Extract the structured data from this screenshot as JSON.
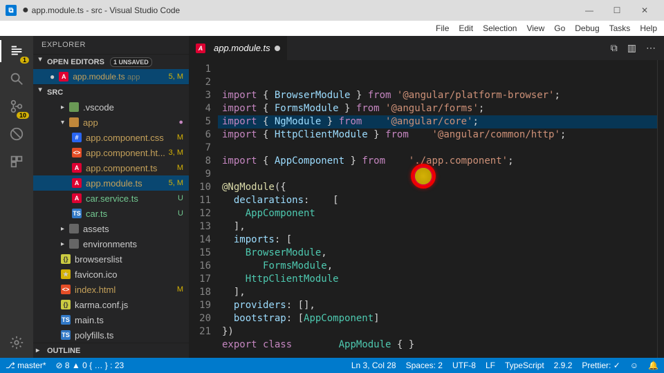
{
  "title": "app.module.ts - src - Visual Studio Code",
  "menu": [
    "Help",
    "Tasks",
    "Debug",
    "Go",
    "View",
    "Selection",
    "Edit",
    "File"
  ],
  "activity": {
    "explorer_badge": "1",
    "scm_badge": "10"
  },
  "explorer": {
    "header": "EXPLORER",
    "open_editors_label": "OPEN EDITORS",
    "unsaved_label": "1 UNSAVED",
    "open_editors": [
      {
        "name": "app.module.ts",
        "hint": "app",
        "status": "5, M",
        "mod": true
      }
    ],
    "root_label": "SRC",
    "tree": [
      {
        "depth": 2,
        "icon": "folder-green",
        "name": ".vscode",
        "chev": "▸"
      },
      {
        "depth": 2,
        "icon": "folder-orange",
        "name": "app",
        "chev": "▾",
        "status": "●",
        "statusClass": "dot",
        "mod": true
      },
      {
        "depth": 3,
        "icon": "css",
        "name": "app.component.css",
        "status": "M",
        "mod": true
      },
      {
        "depth": 3,
        "icon": "html",
        "name": "app.component.ht...",
        "status": "3, M",
        "mod": true
      },
      {
        "depth": 3,
        "icon": "ng",
        "name": "app.component.ts",
        "status": "M",
        "mod": true
      },
      {
        "depth": 3,
        "icon": "ng",
        "name": "app.module.ts",
        "status": "5, M",
        "mod": true,
        "selected": true
      },
      {
        "depth": 3,
        "icon": "ng",
        "name": "car.service.ts",
        "status": "U",
        "new": true
      },
      {
        "depth": 3,
        "icon": "ts",
        "name": "car.ts",
        "status": "U",
        "new": true
      },
      {
        "depth": 2,
        "icon": "folder-grey",
        "name": "assets",
        "chev": "▸"
      },
      {
        "depth": 2,
        "icon": "folder-grey",
        "name": "environments",
        "chev": "▸"
      },
      {
        "depth": 2,
        "icon": "json",
        "name": "browserslist"
      },
      {
        "depth": 2,
        "icon": "ico",
        "name": "favicon.ico"
      },
      {
        "depth": 2,
        "icon": "html",
        "name": "index.html",
        "status": "M",
        "mod": true
      },
      {
        "depth": 2,
        "icon": "json",
        "name": "karma.conf.js"
      },
      {
        "depth": 2,
        "icon": "ts",
        "name": "main.ts"
      },
      {
        "depth": 2,
        "icon": "ts",
        "name": "polyfills.ts"
      }
    ],
    "outline_label": "OUTLINE"
  },
  "tab": {
    "name": "app.module.ts"
  },
  "code_lines": [
    [
      [
        "kw",
        "import"
      ],
      [
        "pun",
        " { "
      ],
      [
        "id",
        "BrowserModule"
      ],
      [
        "pun",
        " } "
      ],
      [
        "kw",
        "from"
      ],
      [
        "pun",
        " "
      ],
      [
        "str",
        "'@angular/platform-browser'"
      ],
      [
        "pun",
        ";"
      ]
    ],
    [
      [
        "kw",
        "import"
      ],
      [
        "pun",
        " { "
      ],
      [
        "id",
        "FormsModule"
      ],
      [
        "pun",
        " } "
      ],
      [
        "kw",
        "from"
      ],
      [
        "pun",
        " "
      ],
      [
        "str",
        "'@angular/forms'"
      ],
      [
        "pun",
        ";"
      ]
    ],
    [
      [
        "kw",
        "import"
      ],
      [
        "pun",
        " { "
      ],
      [
        "id",
        "NgModule"
      ],
      [
        "pun",
        " } "
      ],
      [
        "kw",
        "from"
      ],
      [
        "pun",
        "    "
      ],
      [
        "str",
        "'@angular/core'"
      ],
      [
        "pun",
        ";"
      ]
    ],
    [
      [
        "kw",
        "import"
      ],
      [
        "pun",
        " { "
      ],
      [
        "id",
        "HttpClientModule"
      ],
      [
        "pun",
        " } "
      ],
      [
        "kw",
        "from"
      ],
      [
        "pun",
        "    "
      ],
      [
        "str",
        "'@angular/common/http'"
      ],
      [
        "pun",
        ";"
      ]
    ],
    [],
    [
      [
        "kw",
        "import"
      ],
      [
        "pun",
        " { "
      ],
      [
        "id",
        "AppComponent"
      ],
      [
        "pun",
        " } "
      ],
      [
        "kw",
        "from"
      ],
      [
        "pun",
        "    "
      ],
      [
        "str",
        "'./app.component'"
      ],
      [
        "pun",
        ";"
      ]
    ],
    [],
    [
      [
        "dec",
        "@NgModule"
      ],
      [
        "pun",
        "({"
      ]
    ],
    [
      [
        "pun",
        "  "
      ],
      [
        "id",
        "declarations"
      ],
      [
        "pun",
        ":    ["
      ]
    ],
    [
      [
        "pun",
        "    "
      ],
      [
        "typ",
        "AppComponent"
      ]
    ],
    [
      [
        "pun",
        "  ],"
      ]
    ],
    [
      [
        "pun",
        "  "
      ],
      [
        "id",
        "imports"
      ],
      [
        "pun",
        ": ["
      ]
    ],
    [
      [
        "pun",
        "    "
      ],
      [
        "typ",
        "BrowserModule"
      ],
      [
        "pun",
        ","
      ]
    ],
    [
      [
        "pun",
        "       "
      ],
      [
        "typ",
        "FormsModule"
      ],
      [
        "pun",
        ","
      ]
    ],
    [
      [
        "pun",
        "    "
      ],
      [
        "typ",
        "HttpClientModule"
      ]
    ],
    [
      [
        "pun",
        "  ],"
      ]
    ],
    [
      [
        "pun",
        "  "
      ],
      [
        "id",
        "providers"
      ],
      [
        "pun",
        ": [],"
      ]
    ],
    [
      [
        "pun",
        "  "
      ],
      [
        "id",
        "bootstrap"
      ],
      [
        "pun",
        ": ["
      ],
      [
        "typ",
        "AppComponent"
      ],
      [
        "pun",
        "]"
      ]
    ],
    [
      [
        "pun",
        "})"
      ]
    ],
    [
      [
        "kw",
        "export"
      ],
      [
        "pun",
        " "
      ],
      [
        "kw",
        "class"
      ],
      [
        "pun",
        "        "
      ],
      [
        "typ",
        "AppModule"
      ],
      [
        "pun",
        " { }"
      ]
    ],
    []
  ],
  "status": {
    "branch": "master*",
    "problems": "⊘ 8  ▲ 0  { … } : 23",
    "cursor": "Ln 3, Col 28",
    "spaces": "Spaces: 2",
    "encoding": "UTF-8",
    "eol": "LF",
    "lang": "TypeScript",
    "tsver": "2.9.2",
    "prettier": "Prettier: ✓",
    "feedback": "☺",
    "bell": "🔔"
  }
}
